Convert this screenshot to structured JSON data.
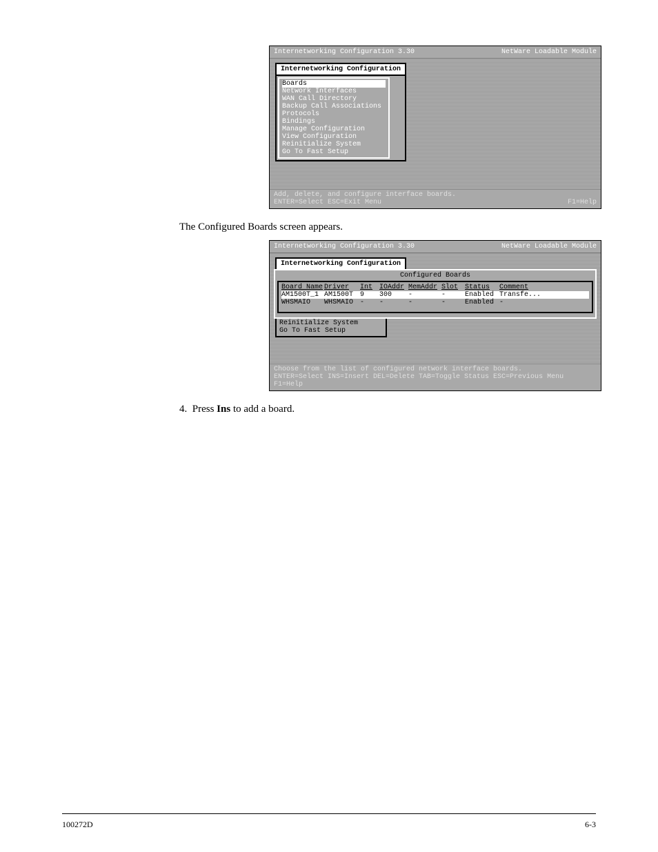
{
  "screenA": {
    "title_left": "Internetworking Configuration  3.30",
    "title_right": "NetWare Loadable Module",
    "panel_title": "Internetworking Configuration",
    "menu": [
      "Boards",
      "Network Interfaces",
      "WAN Call Directory",
      "Backup Call Associations",
      "Protocols",
      "Bindings",
      "Manage Configuration",
      "View Configuration",
      "Reinitialize System",
      "Go To Fast Setup"
    ],
    "menu_selected_index": 0,
    "status_left_line1": "Add, delete, and configure interface boards.",
    "status_left_line2": "ENTER=Select ESC=Exit Menu",
    "status_right": "F1=Help"
  },
  "step3": "The Configured Boards screen appears.",
  "screenB": {
    "title_left": "Internetworking Configuration  3.30",
    "title_right": "NetWare Loadable Module",
    "panel_title": "Internetworking Configuration",
    "boards_title": "Configured Boards",
    "columns": [
      "Board Name",
      "Driver",
      "Int",
      "IOAddr",
      "MemAddr",
      "Slot",
      "Status",
      "Comment"
    ],
    "rows": [
      {
        "cells": [
          "AM1500T_1",
          "AM1500T",
          "9",
          "300",
          "-",
          "-",
          "Enabled",
          "Transfe..."
        ],
        "selected": true
      },
      {
        "cells": [
          "WHSMAIO",
          "WHSMAIO",
          "-",
          "-",
          "-",
          "-",
          "Enabled",
          "-"
        ],
        "selected": false
      }
    ],
    "below_menu": [
      "Reinitialize System",
      "Go To Fast Setup"
    ],
    "status_left_line1": "Choose from the list of configured network interface boards.",
    "status_left_line2": "ENTER=Select INS=Insert DEL=Delete TAB=Toggle Status ESC=Previous Menu F1=Help"
  },
  "step4_prefix": "Press ",
  "step4_key": "Ins",
  "step4_suffix": " to add a board.",
  "footer_left": "100272D",
  "footer_right": "6-3"
}
